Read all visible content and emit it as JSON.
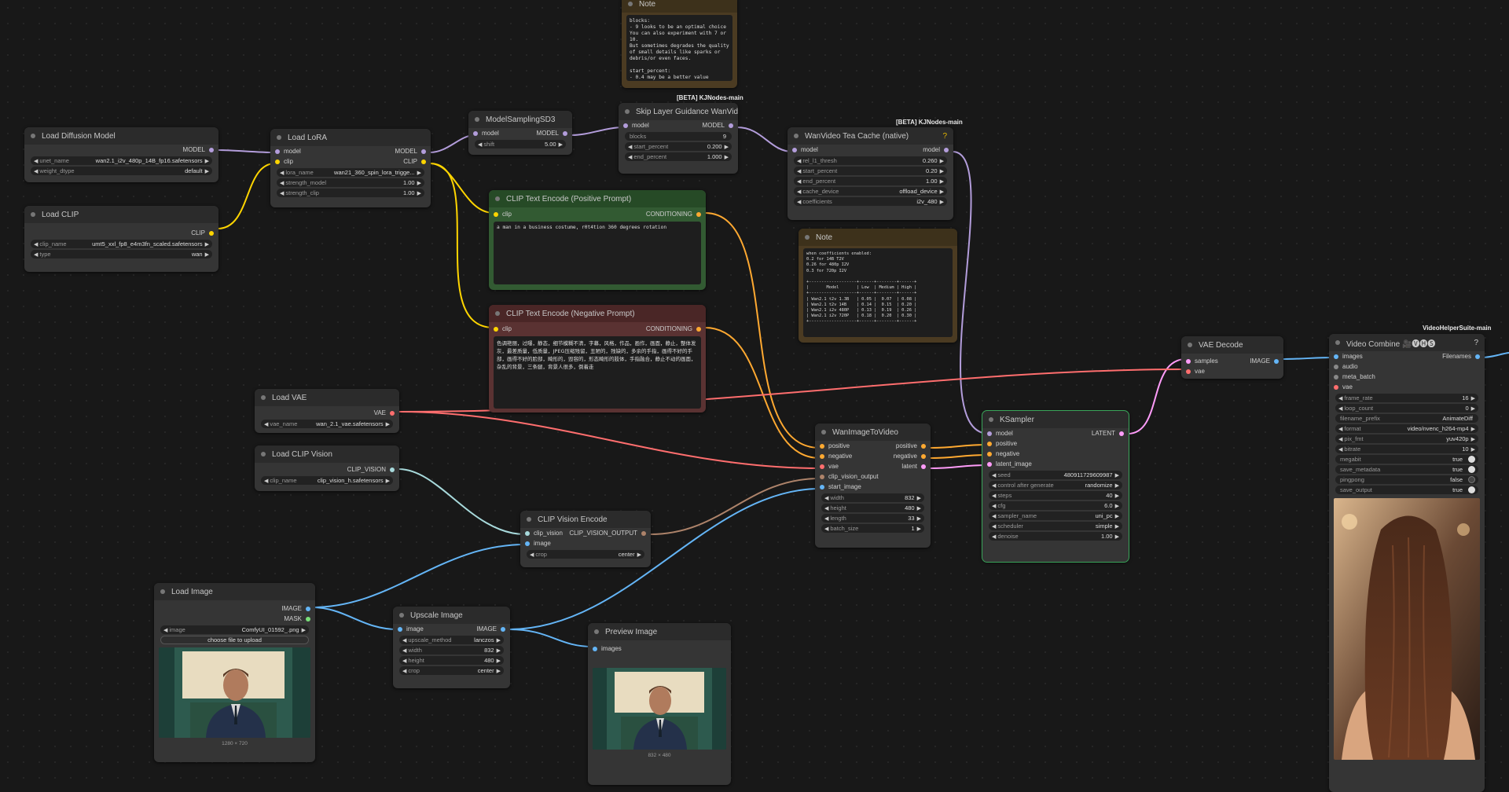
{
  "groups": {
    "kj1": "[BETA] KJNodes-main",
    "kj2": "[BETA] KJNodes-main",
    "vhs": "VideoHelperSuite-main"
  },
  "note_top": {
    "title": "Note",
    "text": "blocks:\n- 9 looks to be an optimal choice\nYou can also experiment with 7 or\n10.\nBut sometimes degrades the quality\nof small details like sparks or\ndebris/or even faces.\n\nstart_percent:\n- 0.4 may be a better value"
  },
  "note_mid": {
    "title": "Note",
    "text": "when coefficients enabled:\n0.2 for 14B T2V\n0.26 for 480p I2V\n0.3 for 720p I2V\n\n+-------------------+------+--------+------+\n|       Model       | Low  | Medium | High |\n+-------------------+------+--------+------+\n| Wan2.1 t2v 1.3B   | 0.05 |  0.07  | 0.08 |\n| Wan2.1 t2v 14B    | 0.14 |  0.15  | 0.20 |\n| Wan2.1 i2v 480P   | 0.13 |  0.19  | 0.26 |\n| Wan2.1 i2v 720P   | 0.18 |  0.20  | 0.30 |\n+-------------------+------+--------+------+"
  },
  "load_diffusion": {
    "title": "Load Diffusion Model",
    "out": "MODEL",
    "w1n": "unet_name",
    "w1v": "wan2.1_i2v_480p_14B_fp16.safetensors",
    "w2n": "weight_dtype",
    "w2v": "default"
  },
  "load_clip": {
    "title": "Load CLIP",
    "out": "CLIP",
    "w1n": "clip_name",
    "w1v": "umt5_xxl_fp8_e4m3fn_scaled.safetensors",
    "w2n": "type",
    "w2v": "wan"
  },
  "load_lora": {
    "title": "Load LoRA",
    "in1": "model",
    "in2": "clip",
    "out1": "MODEL",
    "out2": "CLIP",
    "w1n": "lora_name",
    "w1v": "wan21_360_spin_lora_trigge...",
    "w2n": "strength_model",
    "w2v": "1.00",
    "w3n": "strength_clip",
    "w3v": "1.00"
  },
  "msd3": {
    "title": "ModelSamplingSD3",
    "in1": "model",
    "out1": "MODEL",
    "w1n": "shift",
    "w1v": "5.00"
  },
  "slg": {
    "title": "Skip Layer Guidance WanVideo",
    "in1": "model",
    "out1": "MODEL",
    "w1n": "blocks",
    "w1v": "9",
    "w2n": "start_percent",
    "w2v": "0.200",
    "w3n": "end_percent",
    "w3v": "1.000"
  },
  "teacache": {
    "title": "WanVideo Tea Cache (native)",
    "q": "?",
    "in1": "model",
    "out1": "model",
    "w1n": "rel_l1_thresh",
    "w1v": "0.260",
    "w2n": "start_percent",
    "w2v": "0.20",
    "w3n": "end_percent",
    "w3v": "1.00",
    "w4n": "cache_device",
    "w4v": "offload_device",
    "w5n": "coefficients",
    "w5v": "i2v_480"
  },
  "clip_pos": {
    "title": "CLIP Text Encode (Positive Prompt)",
    "in1": "clip",
    "out1": "CONDITIONING",
    "text": "a man in a business costume, r0t4tion 360 degrees rotation"
  },
  "clip_neg": {
    "title": "CLIP Text Encode (Negative Prompt)",
    "in1": "clip",
    "out1": "CONDITIONING",
    "text": "色调艳丽，过曝，静态，细节模糊不清，字幕，风格，作品，画作，画面，静止，整体发灰，最差质量，低质量，JPEG压缩残留，丑陋的，残缺的，多余的手指，画得不好的手部，画得不好的脸部，畸形的，毁容的，形态畸形的肢体，手指融合，静止不动的画面，杂乱的背景，三条腿，背景人很多，倒着走"
  },
  "load_vae": {
    "title": "Load VAE",
    "out": "VAE",
    "w1n": "vae_name",
    "w1v": "wan_2.1_vae.safetensors"
  },
  "load_clipvision": {
    "title": "Load CLIP Vision",
    "out": "CLIP_VISION",
    "w1n": "clip_name",
    "w1v": "clip_vision_h.safetensors"
  },
  "clip_vision_encode": {
    "title": "CLIP Vision Encode",
    "in1": "clip_vision",
    "in2": "image",
    "out1": "CLIP_VISION_OUTPUT",
    "w1n": "crop",
    "w1v": "center"
  },
  "load_image": {
    "title": "Load Image",
    "out1": "IMAGE",
    "out2": "MASK",
    "w1n": "image",
    "w1v": "ComfyUI_01592_.png",
    "upload": "choose file to upload",
    "caption": "1280 × 720"
  },
  "upscale": {
    "title": "Upscale Image",
    "in1": "image",
    "out1": "IMAGE",
    "w1n": "upscale_method",
    "w1v": "lanczos",
    "w2n": "width",
    "w2v": "832",
    "w3n": "height",
    "w3v": "480",
    "w4n": "crop",
    "w4v": "center"
  },
  "preview": {
    "title": "Preview Image",
    "in1": "images",
    "caption": "832 × 480"
  },
  "wan_i2v": {
    "title": "WanImageToVideo",
    "in1": "positive",
    "in2": "negative",
    "in3": "vae",
    "in4": "clip_vision_output",
    "in5": "start_image",
    "out1": "positive",
    "out2": "negative",
    "out3": "latent",
    "w1n": "width",
    "w1v": "832",
    "w2n": "height",
    "w2v": "480",
    "w3n": "length",
    "w3v": "33",
    "w4n": "batch_size",
    "w4v": "1"
  },
  "ksampler": {
    "title": "KSampler",
    "in1": "model",
    "in2": "positive",
    "in3": "negative",
    "in4": "latent_image",
    "out1": "LATENT",
    "w1n": "seed",
    "w1v": "480911729609987",
    "w2n": "control after generate",
    "w2v": "randomize",
    "w3n": "steps",
    "w3v": "40",
    "w4n": "cfg",
    "w4v": "6.0",
    "w5n": "sampler_name",
    "w5v": "uni_pc",
    "w6n": "scheduler",
    "w6v": "simple",
    "w7n": "denoise",
    "w7v": "1.00"
  },
  "vae_decode": {
    "title": "VAE Decode",
    "in1": "samples",
    "in2": "vae",
    "out1": "IMAGE"
  },
  "video_combine": {
    "title": "Video Combine 🎥🅥🅗🅢",
    "q": "?",
    "in1": "images",
    "in2": "audio",
    "in3": "meta_batch",
    "in4": "vae",
    "out1": "Filenames",
    "w1n": "frame_rate",
    "w1v": "16",
    "w2n": "loop_count",
    "w2v": "0",
    "w3n": "filename_prefix",
    "w3v": "AnimateDiff",
    "w4n": "format",
    "w4v": "video/nvenc_h264-mp4",
    "w5n": "pix_fmt",
    "w5v": "yuv420p",
    "w6n": "bitrate",
    "w6v": "10",
    "w7n": "megabit",
    "w7v": "true",
    "w8n": "save_metadata",
    "w8v": "true",
    "w9n": "pingpong",
    "w9v": "false",
    "w10n": "save_output",
    "w10v": "true"
  },
  "colors": {
    "model": "#b39ddb",
    "clip": "#ffd500",
    "conditioning": "#ffa931",
    "vae": "#ff6e6e",
    "image": "#64b5f6",
    "clip_vision": "#a8dadc",
    "latent": "#ff9cf9",
    "clip_vision_output": "#ad836a"
  }
}
